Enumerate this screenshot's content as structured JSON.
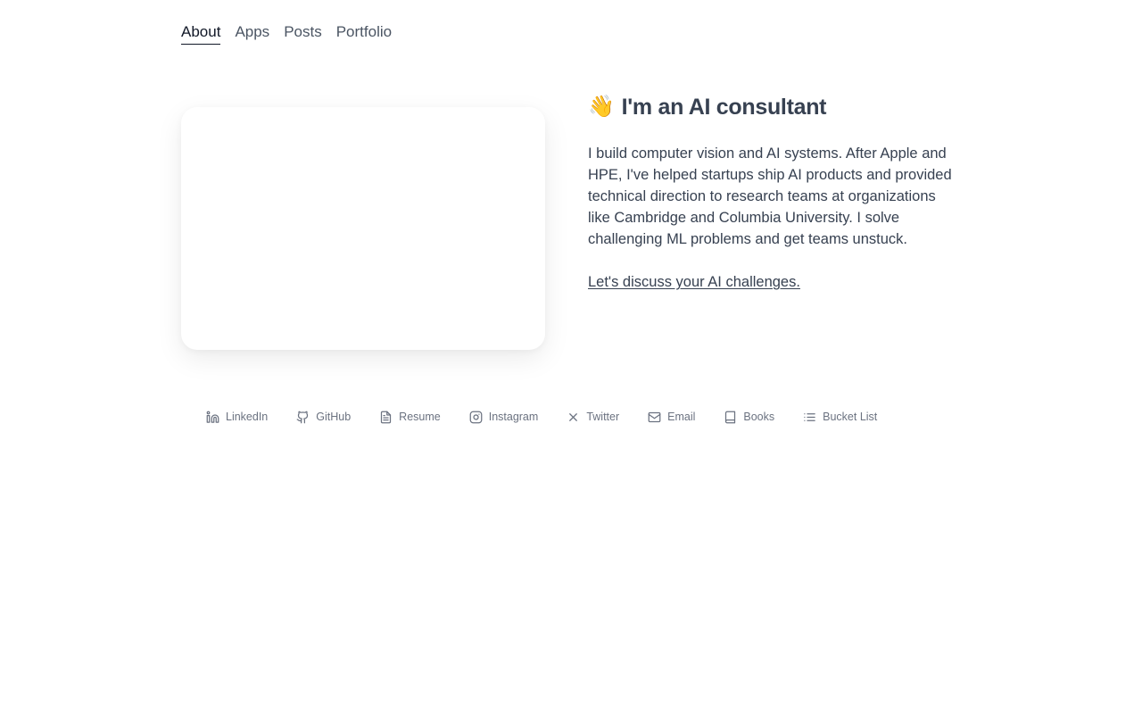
{
  "nav": {
    "items": [
      {
        "label": "About",
        "active": true
      },
      {
        "label": "Apps",
        "active": false
      },
      {
        "label": "Posts",
        "active": false
      },
      {
        "label": "Portfolio",
        "active": false
      }
    ]
  },
  "hero": {
    "emoji": "👋",
    "title": "I'm an AI consultant",
    "bio": "I build computer vision and AI systems. After Apple and HPE, I've helped startups ship AI products and provided technical direction to research teams at organizations like Cambridge and Columbia University. I solve challenging ML problems and get teams unstuck.",
    "cta": "Let's discuss your AI challenges."
  },
  "social_links": [
    {
      "label": "LinkedIn",
      "icon": "linkedin-icon"
    },
    {
      "label": "GitHub",
      "icon": "github-icon"
    },
    {
      "label": "Resume",
      "icon": "document-icon"
    },
    {
      "label": "Instagram",
      "icon": "instagram-icon"
    },
    {
      "label": "Twitter",
      "icon": "x-icon"
    },
    {
      "label": "Email",
      "icon": "mail-icon"
    },
    {
      "label": "Books",
      "icon": "book-icon"
    },
    {
      "label": "Bucket List",
      "icon": "list-icon"
    }
  ],
  "colors": {
    "text": "#374151",
    "muted": "#6b7280",
    "active": "#111827"
  }
}
